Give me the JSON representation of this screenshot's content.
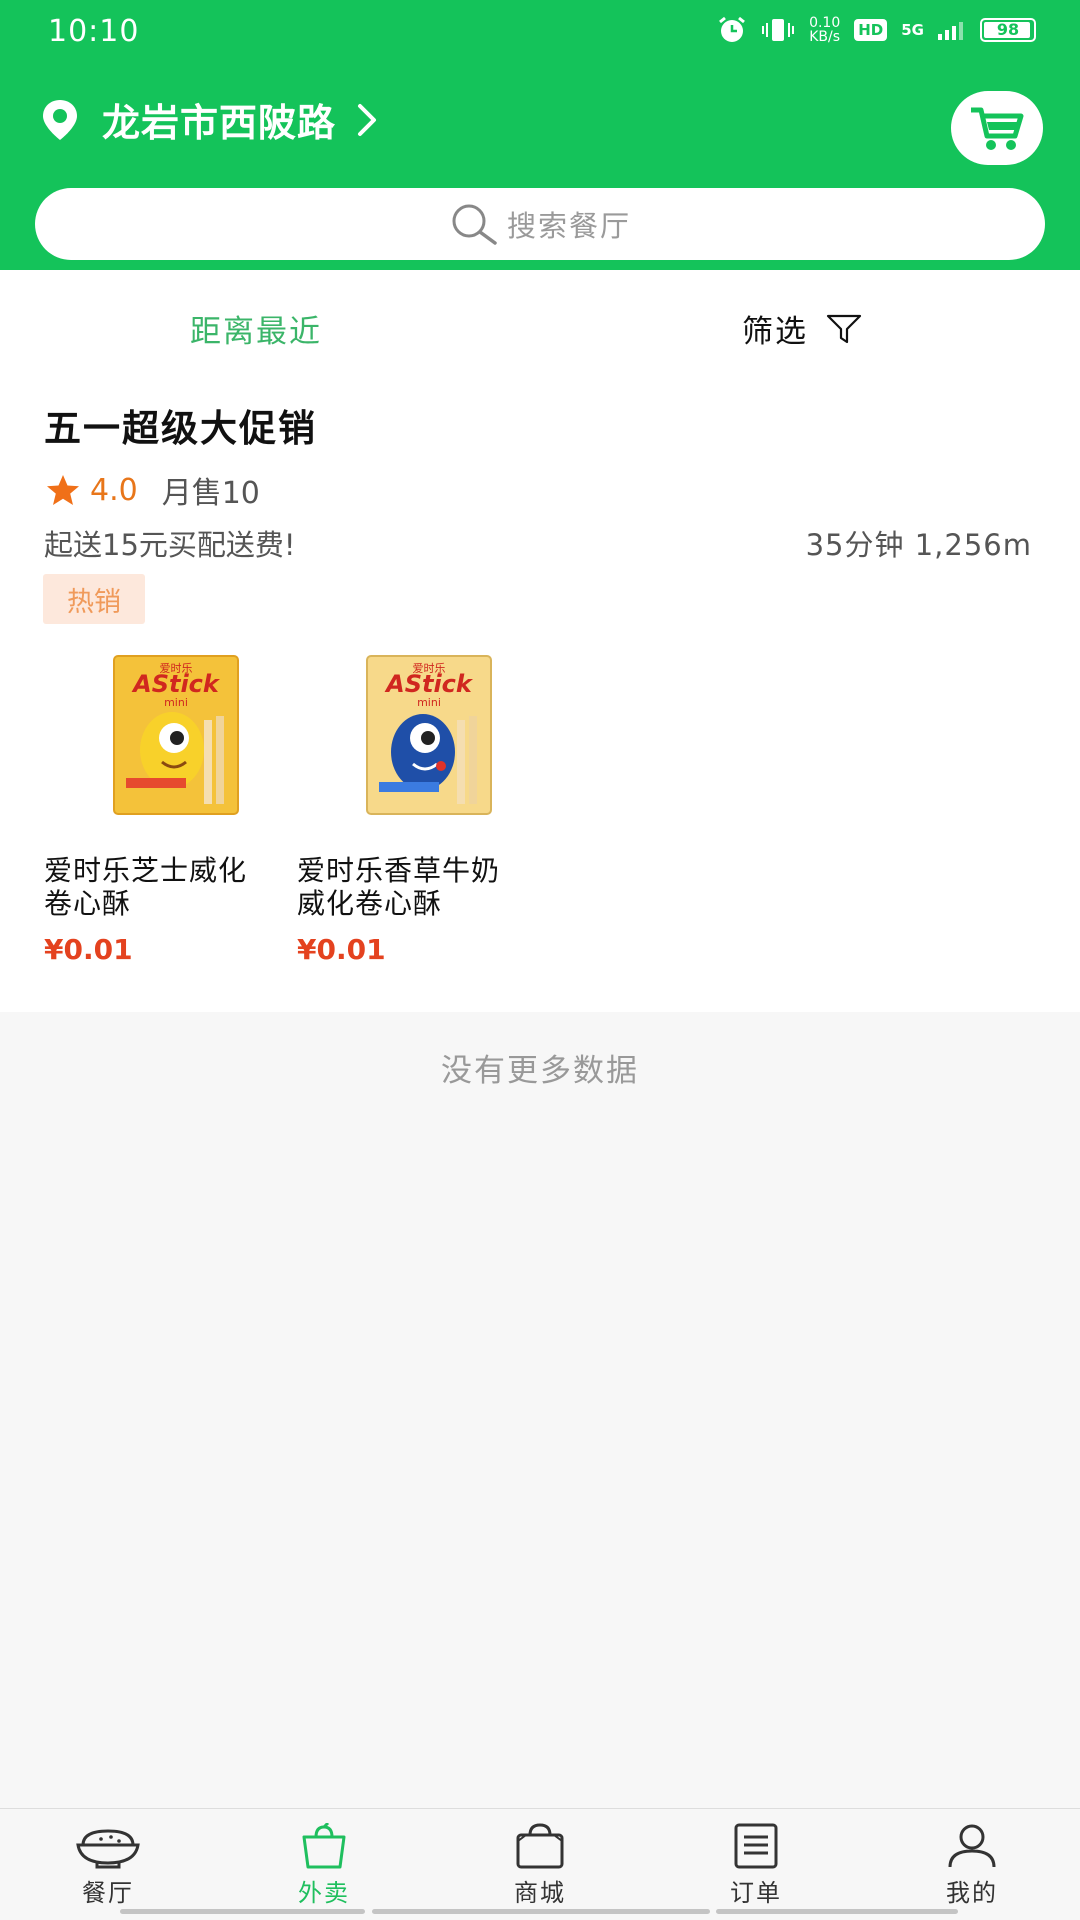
{
  "status_bar": {
    "time": "10:10",
    "net_speed_top": "0.10",
    "net_speed_bottom": "KB/s",
    "hd": "HD",
    "network": "5G",
    "battery": "98"
  },
  "header": {
    "location": "龙岩市西陂路",
    "search_placeholder": "搜索餐厅",
    "brand_color": "#14c35a"
  },
  "sort_bar": {
    "nearest": "距离最近",
    "filter": "筛选"
  },
  "shop": {
    "name": "五一超级大促销",
    "rating": "4.0",
    "monthly_sales": "月售10",
    "delivery_info": "起送15元买配送费!",
    "delivery_time_distance": "35分钟  1,256m",
    "badge": "热销",
    "products": [
      {
        "name": "爱时乐芝士威化卷心酥",
        "price": "¥0.01",
        "box_brand": "爱时乐",
        "box_title": "AStick",
        "box_sub": "mini"
      },
      {
        "name": "爱时乐香草牛奶威化卷心酥",
        "price": "¥0.01",
        "box_brand": "爱时乐",
        "box_title": "AStick",
        "box_sub": "mini"
      }
    ]
  },
  "no_more_text": "没有更多数据",
  "bottom_nav": [
    {
      "label": "餐厅",
      "icon": "bowl-icon",
      "active": false
    },
    {
      "label": "外卖",
      "icon": "bag-icon",
      "active": true
    },
    {
      "label": "商城",
      "icon": "shopping-bag-icon",
      "active": false
    },
    {
      "label": "订单",
      "icon": "order-list-icon",
      "active": false
    },
    {
      "label": "我的",
      "icon": "user-icon",
      "active": false
    }
  ]
}
